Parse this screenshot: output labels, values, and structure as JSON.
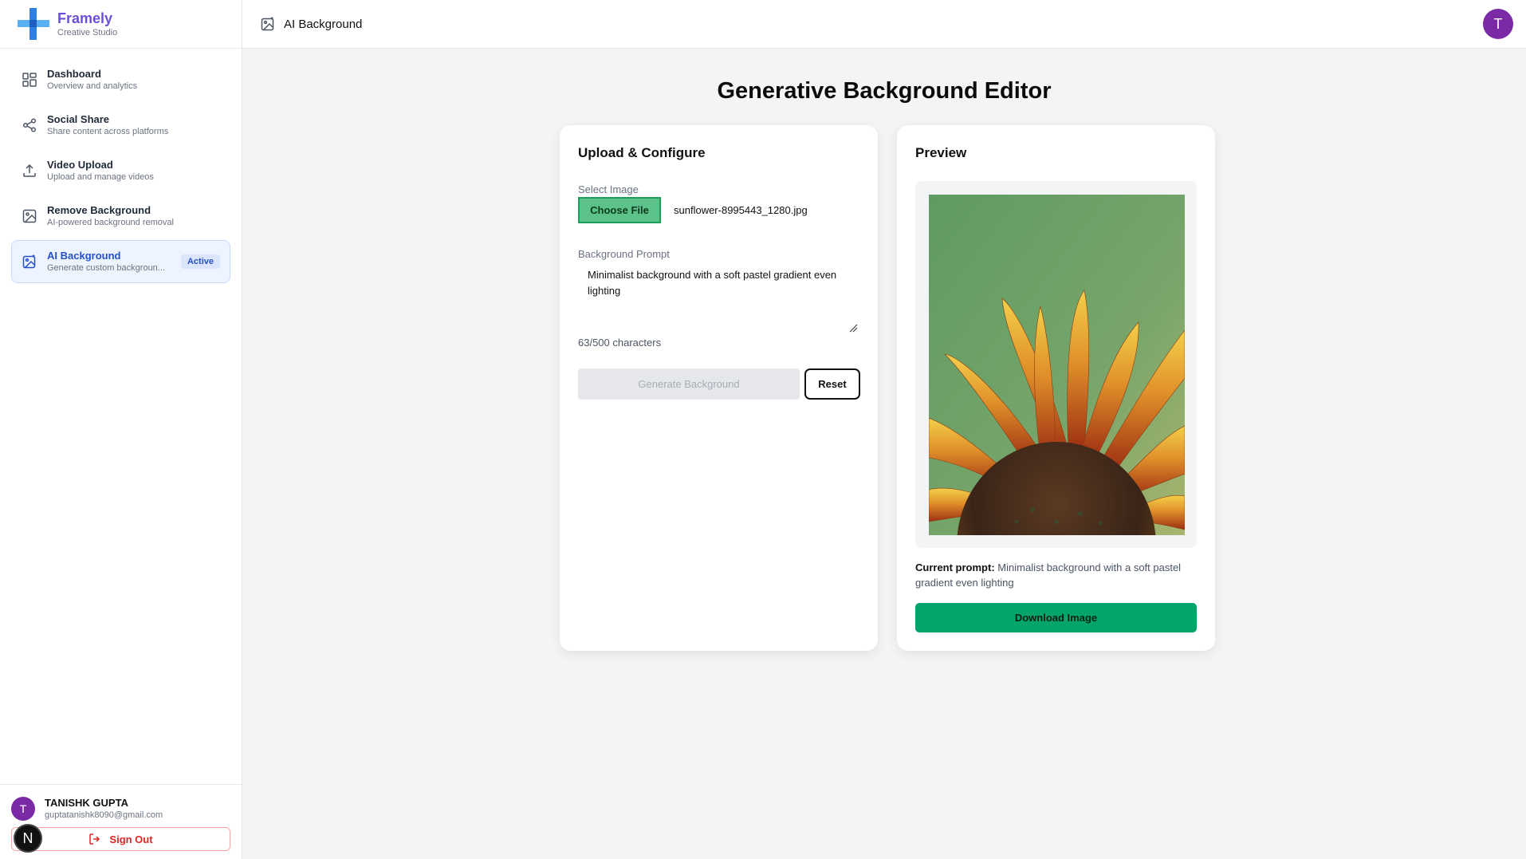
{
  "brand": {
    "name": "Framely",
    "tagline": "Creative Studio"
  },
  "header": {
    "title": "AI Background",
    "avatar_initial": "T"
  },
  "sidebar": {
    "items": [
      {
        "title": "Dashboard",
        "description": "Overview and analytics",
        "icon": "dashboard-grid-icon"
      },
      {
        "title": "Social Share",
        "description": "Share content across platforms",
        "icon": "share-icon"
      },
      {
        "title": "Video Upload",
        "description": "Upload and manage videos",
        "icon": "upload-icon"
      },
      {
        "title": "Remove Background",
        "description": "AI-powered background removal",
        "icon": "image-icon"
      },
      {
        "title": "AI Background",
        "description": "Generate custom backgroun...",
        "icon": "image-sparkle-icon",
        "active": true,
        "badge": "Active"
      }
    ]
  },
  "user": {
    "initial": "T",
    "name": "TANISHK GUPTA",
    "email": "guptatanishk8090@gmail.com",
    "signout_label": "Sign Out"
  },
  "dev_badge": "N",
  "main": {
    "title": "Generative Background Editor",
    "upload_card": {
      "heading": "Upload & Configure",
      "select_image_label": "Select Image",
      "choose_file_label": "Choose File",
      "file_name": "sunflower-8995443_1280.jpg",
      "prompt_label": "Background Prompt",
      "prompt_value": "Minimalist background with a soft pastel gradient even lighting",
      "char_count": "63/500 characters",
      "generate_label": "Generate Background",
      "reset_label": "Reset"
    },
    "preview_card": {
      "heading": "Preview",
      "current_prompt_label": "Current prompt:",
      "current_prompt_value": "Minimalist background with a soft pastel gradient even lighting",
      "download_label": "Download Image"
    }
  },
  "colors": {
    "accent_purple": "#6d4fd6",
    "active_blue": "#2450c8",
    "download_green": "#03a56b",
    "choose_green": "#5cc28a",
    "avatar": "#7b2aa6"
  }
}
